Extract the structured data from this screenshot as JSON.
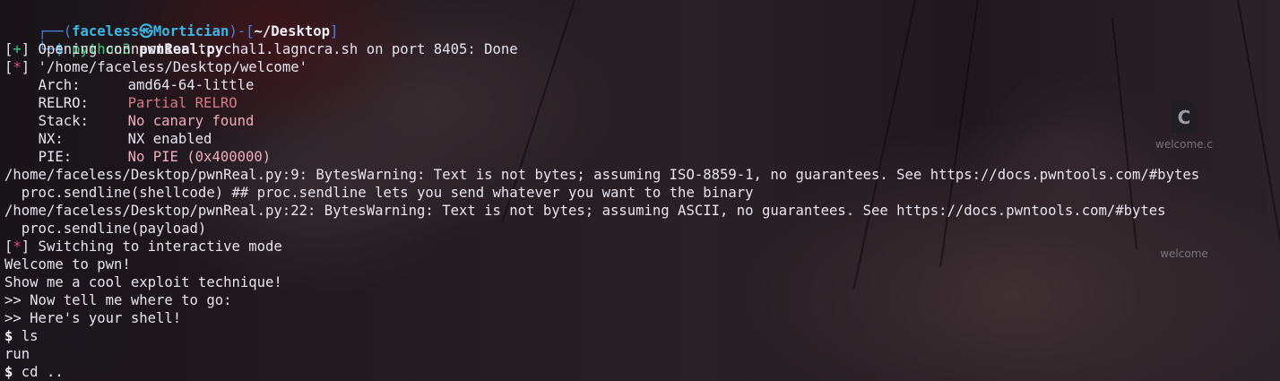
{
  "prompt": {
    "corner_top": "┌──",
    "open_paren": "(",
    "user": "faceless",
    "skull": "㉿",
    "host": "Mortician",
    "mid": ")-[",
    "cwd": "~/Desktop",
    "close": "]",
    "corner_bottom": "└─",
    "dollar": "$",
    "cmd": "python3",
    "arg": "pwnReal.py"
  },
  "output": {
    "opening_bracket_open": "[",
    "opening_mark": "+",
    "opening_bracket_close": "]",
    "opening_text": " Opening connection to chal1.lagncra.sh on port 8405: Done",
    "elf_bracket_open": "[",
    "elf_mark": "*",
    "elf_bracket_close": "]",
    "elf_text": " '/home/faceless/Desktop/welcome'",
    "checksec": [
      {
        "key": "Arch:",
        "value": "amd64-64-little",
        "level": "neutral"
      },
      {
        "key": "RELRO:",
        "value": "Partial RELRO",
        "level": "warn"
      },
      {
        "key": "Stack:",
        "value": "No canary found",
        "level": "bad"
      },
      {
        "key": "NX:",
        "value": "NX enabled",
        "level": "good"
      },
      {
        "key": "PIE:",
        "value": "No PIE (0x400000)",
        "level": "bad"
      }
    ],
    "warning1": "/home/faceless/Desktop/pwnReal.py:9: BytesWarning: Text is not bytes; assuming ISO-8859-1, no guarantees. See https://docs.pwntools.com/#bytes",
    "warning1_code": "  proc.sendline(shellcode) ## proc.sendline lets you send whatever you want to the binary",
    "warning2": "/home/faceless/Desktop/pwnReal.py:22: BytesWarning: Text is not bytes; assuming ASCII, no guarantees. See https://docs.pwntools.com/#bytes",
    "warning2_code": "  proc.sendline(payload)",
    "interactive_bracket_open": "[",
    "interactive_mark": "*",
    "interactive_bracket_close": "]",
    "interactive_text": " Switching to interactive mode",
    "welcome": "Welcome to pwn!",
    "show": "Show me a cool exploit technique!",
    "tell": ">> Now tell me where to go:",
    "shell": ">> Here's your shell!",
    "ls_prompt": "$",
    "ls_cmd": " ls",
    "ls_result": "run",
    "cd_prompt": "$",
    "cd_cmd": " cd .."
  },
  "desktop": {
    "icons": [
      {
        "label": "welcome.c",
        "glyph": "C"
      },
      {
        "label": "welcome"
      }
    ]
  },
  "colors": {
    "prompt_frame": "#4f7fe0",
    "prompt_user": "#39b8e6",
    "plus_mark": "#3bd17a",
    "star_mark": "#e0506a",
    "checksec_warn": "#d9788a",
    "checksec_bad": "#f3a9bd",
    "foreground": "#e8e4ee"
  }
}
